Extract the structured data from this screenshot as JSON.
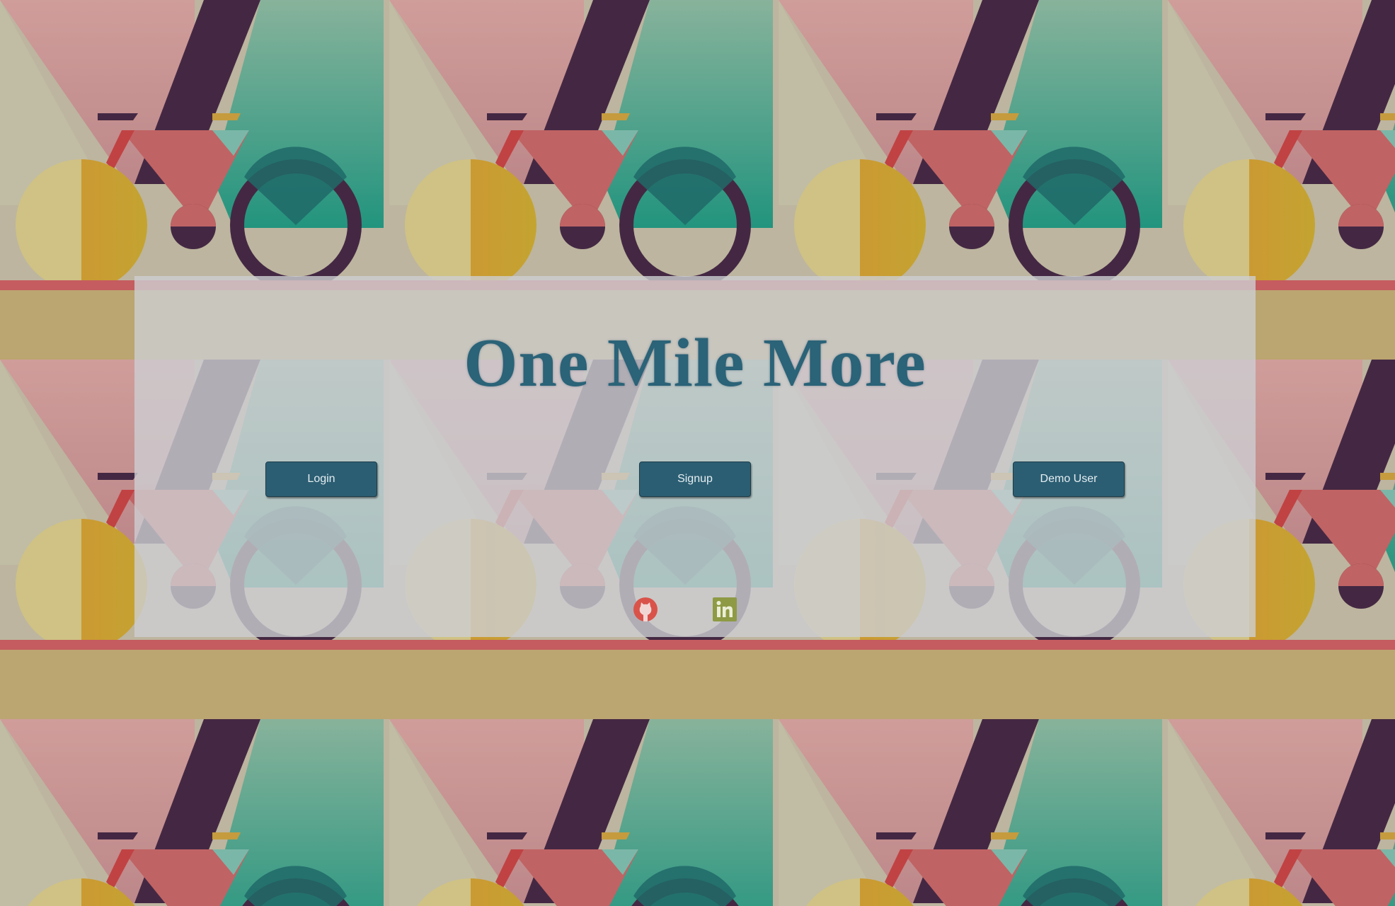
{
  "page": {
    "title": "One Mile More"
  },
  "buttons": {
    "login_label": "Login",
    "signup_label": "Signup",
    "demo_label": "Demo User"
  },
  "social": {
    "github_icon": "github-icon",
    "linkedin_icon": "linkedin-icon"
  },
  "colors": {
    "title": "#2b6378",
    "button_bg": "#2c5e73",
    "button_text": "#e4eef2",
    "panel_bg": "#cdced2",
    "github": "#d9534a",
    "linkedin": "#8f9a44"
  }
}
